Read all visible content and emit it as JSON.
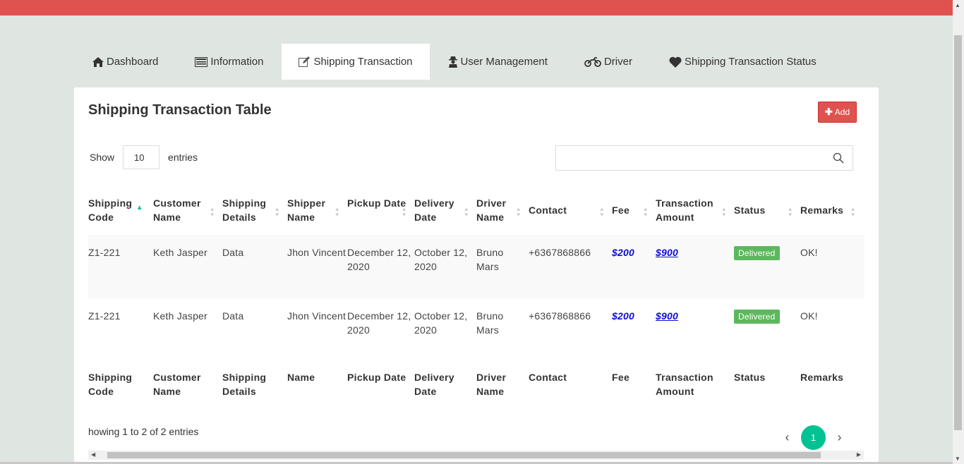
{
  "colors": {
    "topbar": "#de5350",
    "add_button": "#de5350",
    "status_badge": "#5cb85c",
    "page_active": "#00c292",
    "link_money": "#0d0dd5"
  },
  "nav": {
    "tabs": [
      {
        "label": "Dashboard",
        "icon": "home-icon"
      },
      {
        "label": "Information",
        "icon": "list-icon"
      },
      {
        "label": "Shipping Transaction",
        "icon": "edit-icon",
        "active": true
      },
      {
        "label": "User Management",
        "icon": "user-secret-icon"
      },
      {
        "label": "Driver",
        "icon": "motorcycle-icon"
      },
      {
        "label": "Shipping Transaction Status",
        "icon": "heart-icon"
      }
    ]
  },
  "card": {
    "title": "Shipping Transaction Table",
    "add_label": "Add"
  },
  "controls": {
    "show_label": "Show",
    "page_length": "10",
    "entries_label": "entries",
    "search_value": ""
  },
  "table": {
    "columns": [
      "Shipping Code",
      "Customer Name",
      "Shipping Details",
      "Shipper Name",
      "Pickup Date",
      "Delivery Date",
      "Driver Name",
      "Contact",
      "Fee",
      "Transaction Amount",
      "Status",
      "Remarks"
    ],
    "footer_columns": [
      "Shipping Code",
      "Customer Name",
      "Shipping Details",
      "Name",
      "Pickup Date",
      "Delivery Date",
      "Driver Name",
      "Contact",
      "Fee",
      "Transaction Amount",
      "Status",
      "Remarks"
    ],
    "rows": [
      {
        "code": "Z1-221",
        "customer": "Keth Jasper",
        "details": "Data",
        "shipper": "Jhon Vincent",
        "pickup": "December 12, 2020",
        "delivery": "October 12, 2020",
        "driver": "Bruno Mars",
        "contact": "+6367868866",
        "fee": "$200",
        "amount": "$900",
        "status": "Delivered",
        "remarks": "OK!"
      },
      {
        "code": "Z1-221",
        "customer": "Keth Jasper",
        "details": "Data",
        "shipper": "Jhon Vincent",
        "pickup": "December 12, 2020",
        "delivery": "October 12, 2020",
        "driver": "Bruno Mars",
        "contact": "+6367868866",
        "fee": "$200",
        "amount": "$900",
        "status": "Delivered",
        "remarks": "OK!"
      }
    ]
  },
  "footer": {
    "info": "howing 1 to 2 of 2 entries",
    "current_page": "1"
  }
}
